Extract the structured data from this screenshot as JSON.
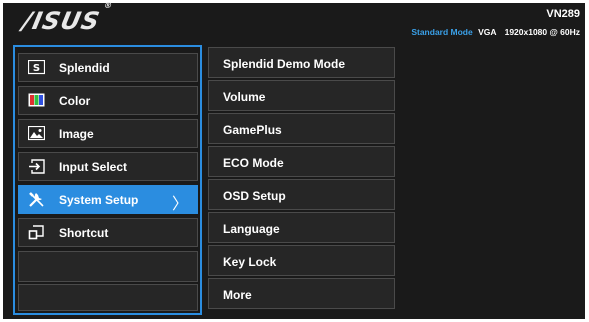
{
  "header": {
    "brand": "/ISUS",
    "reg_mark": "®",
    "model": "VN289",
    "mode_label": "Standard Mode",
    "input": "VGA",
    "resolution": "1920x1080 @ 60Hz"
  },
  "main_menu": {
    "items": [
      {
        "label": "Splendid",
        "icon": "splendid-icon"
      },
      {
        "label": "Color",
        "icon": "color-icon"
      },
      {
        "label": "Image",
        "icon": "image-icon"
      },
      {
        "label": "Input Select",
        "icon": "input-select-icon"
      },
      {
        "label": "System Setup",
        "icon": "tools-icon",
        "selected": true
      },
      {
        "label": "Shortcut",
        "icon": "shortcut-icon"
      },
      {
        "label": ""
      },
      {
        "label": ""
      }
    ],
    "chevron": "〉"
  },
  "sub_menu": {
    "items": [
      {
        "label": "Splendid Demo Mode"
      },
      {
        "label": "Volume"
      },
      {
        "label": "GamePlus"
      },
      {
        "label": "ECO Mode"
      },
      {
        "label": "OSD Setup"
      },
      {
        "label": "Language"
      },
      {
        "label": "Key Lock"
      },
      {
        "label": "More"
      }
    ]
  },
  "colors": {
    "accent": "#2b8de0",
    "mode_text": "#3aa0e8",
    "background": "#1a1a1a",
    "item_bg": "#262626"
  }
}
